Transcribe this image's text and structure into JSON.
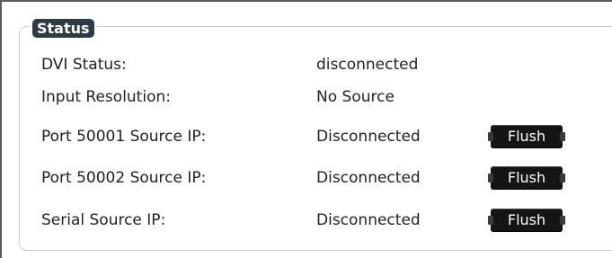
{
  "status": {
    "legend": "Status",
    "rows": [
      {
        "label": "DVI Status:",
        "value": "disconnected"
      },
      {
        "label": "Input Resolution:",
        "value": "No Source"
      },
      {
        "label": "Port 50001 Source IP:",
        "value": "Disconnected",
        "button": "Flush"
      },
      {
        "label": "Port 50002 Source IP:",
        "value": "Disconnected",
        "button": "Flush"
      },
      {
        "label": "Serial Source IP:",
        "value": "Disconnected",
        "button": "Flush"
      }
    ]
  },
  "colors": {
    "legend_bg": "#2f3a45",
    "button_bg": "#151515",
    "border": "#cfcfcf"
  }
}
